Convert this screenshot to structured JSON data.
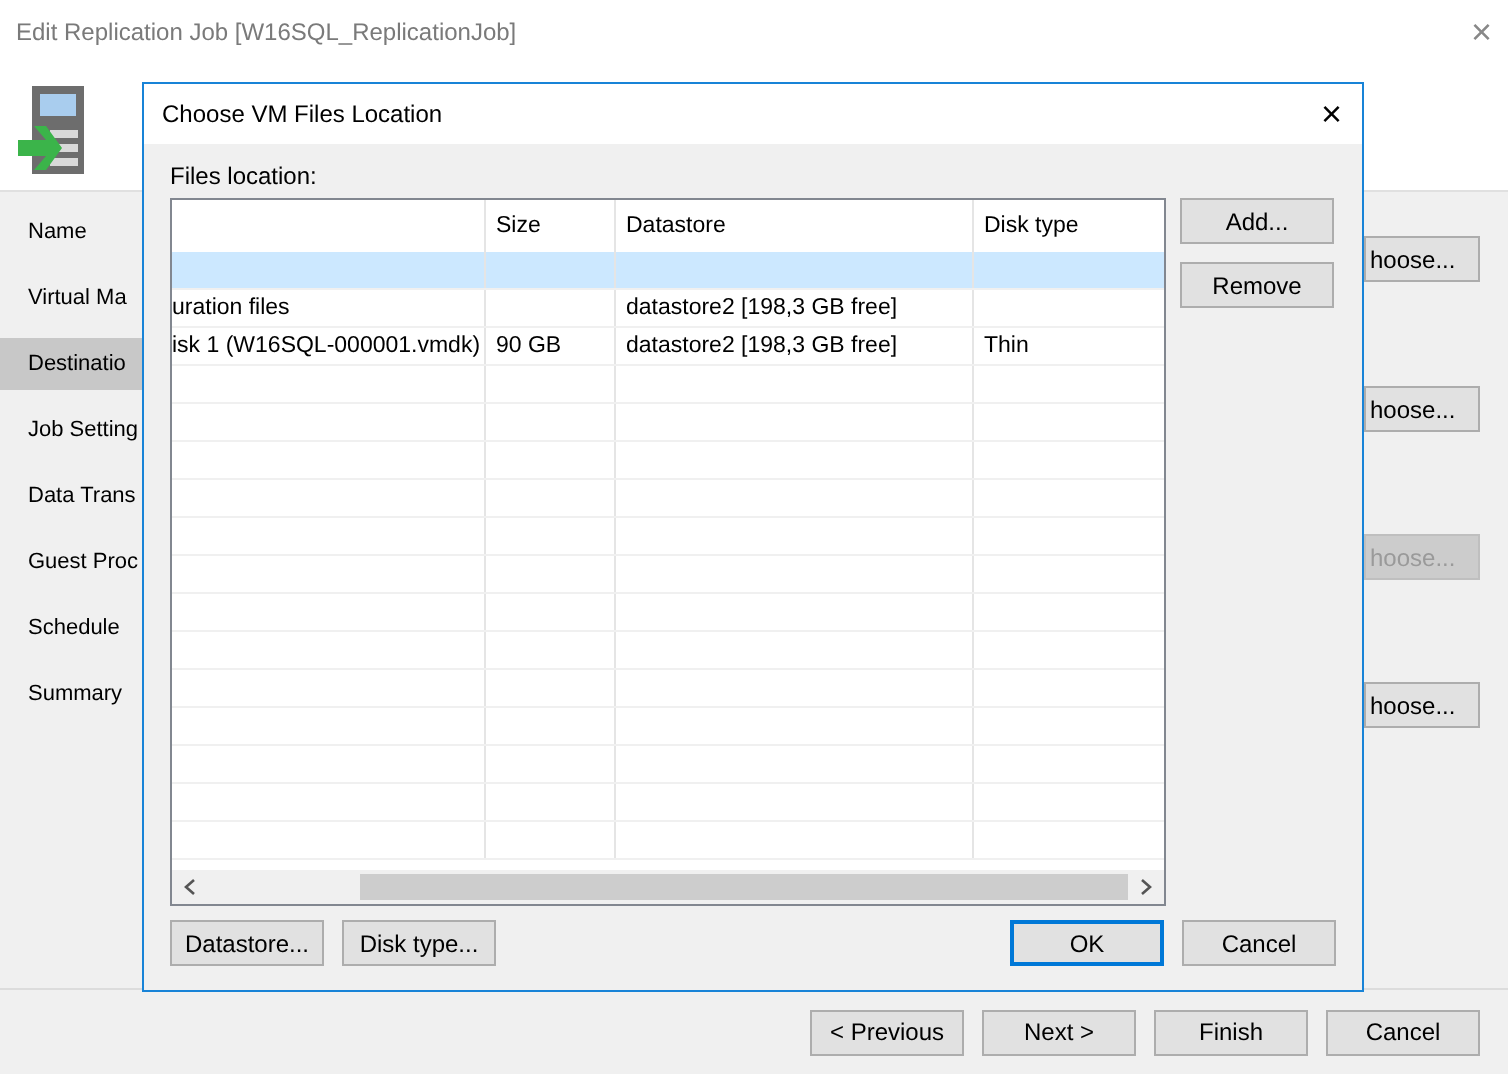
{
  "window": {
    "title": "Edit Replication Job [W16SQL_ReplicationJob]",
    "close": "×"
  },
  "sidebar": {
    "items": [
      {
        "label": "Name",
        "selected": false
      },
      {
        "label": "Virtual Ma",
        "selected": false
      },
      {
        "label": "Destinatio",
        "selected": true
      },
      {
        "label": "Job Setting",
        "selected": false
      },
      {
        "label": "Data Trans",
        "selected": false
      },
      {
        "label": "Guest Proc",
        "selected": false
      },
      {
        "label": "Schedule",
        "selected": false
      },
      {
        "label": "Summary",
        "selected": false
      }
    ]
  },
  "choose_buttons": [
    {
      "label": "hoose...",
      "disabled": false
    },
    {
      "label": "hoose...",
      "disabled": false
    },
    {
      "label": "hoose...",
      "disabled": true
    },
    {
      "label": "hoose...",
      "disabled": false
    }
  ],
  "footer": {
    "buttons": [
      "< Previous",
      "Next >",
      "Finish",
      "Cancel"
    ]
  },
  "dialog": {
    "title": "Choose VM Files Location",
    "close": "×",
    "label": "Files location:",
    "table": {
      "columns": [
        "Size",
        "Datastore",
        "Disk type"
      ],
      "rows": [
        {
          "selected": true
        },
        {
          "selected": false,
          "name": "uration files",
          "datastore": "datastore2 [198,3 GB free]"
        },
        {
          "selected": false,
          "name": "isk 1 (W16SQL-000001.vmdk)",
          "size": "90 GB",
          "datastore": "datastore2 [198,3 GB free]",
          "disk_type": "Thin"
        }
      ]
    },
    "side_buttons": [
      "Add...",
      "Remove"
    ],
    "bottom_left_buttons": [
      "Datastore...",
      "Disk type..."
    ],
    "ok": "OK",
    "cancel": "Cancel"
  }
}
